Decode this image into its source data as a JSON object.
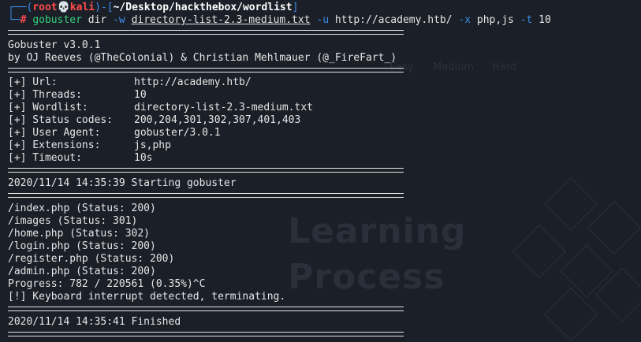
{
  "prompt": {
    "user": "root",
    "skull": "💀",
    "host": "kali",
    "cwd": "~/Desktop/hackthebox/wordlist",
    "symbol": "#"
  },
  "command": {
    "program": "gobuster",
    "sub": "dir",
    "flag_w": "-w",
    "wordlist": "directory-list-2.3-medium.txt",
    "flag_u": "-u",
    "url": "http://academy.htb/",
    "flag_x": "-x",
    "ext": "php,js",
    "flag_t": "-t",
    "threads": "10"
  },
  "banner": {
    "version": "Gobuster v3.0.1",
    "authors": "by OJ Reeves (@TheColonial) & Christian Mehlmauer (@_FireFart_)"
  },
  "config": [
    {
      "key": "[+] Url:",
      "value": "http://academy.htb/"
    },
    {
      "key": "[+] Threads:",
      "value": "10"
    },
    {
      "key": "[+] Wordlist:",
      "value": "directory-list-2.3-medium.txt"
    },
    {
      "key": "[+] Status codes:",
      "value": "200,204,301,302,307,401,403"
    },
    {
      "key": "[+] User Agent:",
      "value": "gobuster/3.0.1"
    },
    {
      "key": "[+] Extensions:",
      "value": "js,php"
    },
    {
      "key": "[+] Timeout:",
      "value": "10s"
    }
  ],
  "start_line": "2020/11/14 14:35:39 Starting gobuster",
  "results": [
    "/index.php (Status: 200)",
    "/images (Status: 301)",
    "/home.php (Status: 302)",
    "/login.php (Status: 200)",
    "/register.php (Status: 200)",
    "/admin.php (Status: 200)"
  ],
  "progress": "Progress: 782 / 220561 (0.35%)^C",
  "interrupt": "[!] Keyboard interrupt detected, terminating.",
  "finish_line": "2020/11/14 14:35:41 Finished",
  "background": {
    "word1": "Learning",
    "word2": "Process",
    "nav": [
      "Easy",
      "Medium",
      "Hard"
    ]
  }
}
